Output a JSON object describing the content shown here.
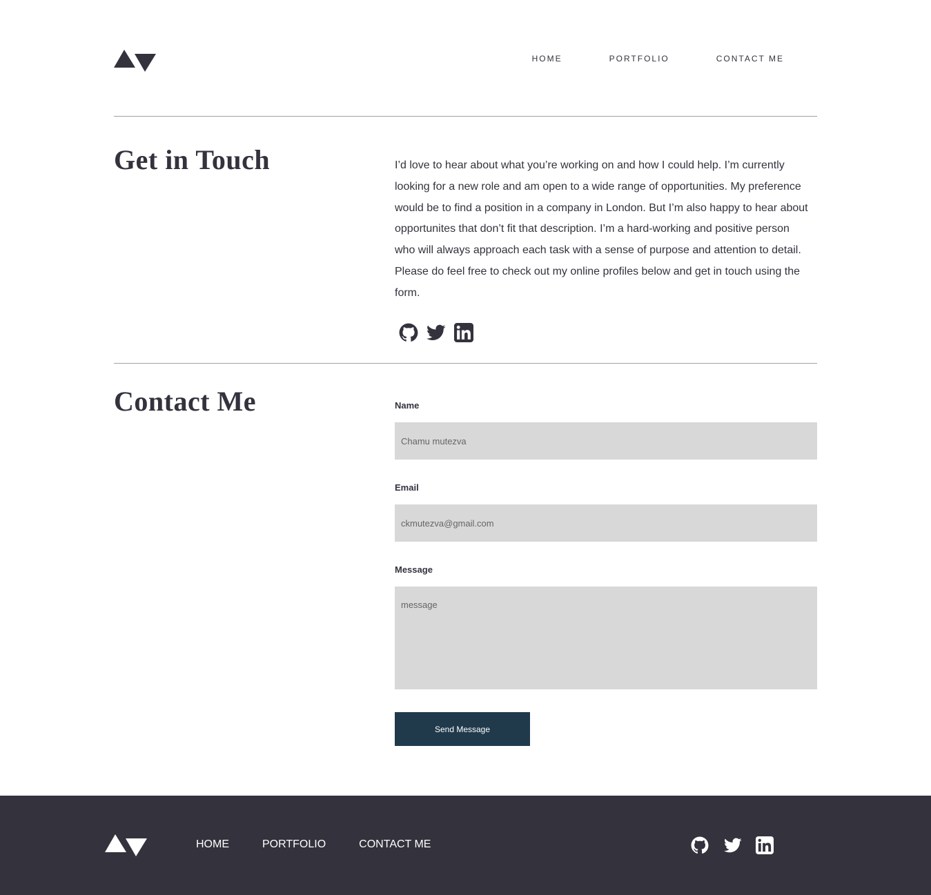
{
  "header": {
    "nav": {
      "home": "HOME",
      "portfolio": "PORTFOLIO",
      "contact": "CONTACT ME"
    }
  },
  "get_in_touch": {
    "title": "Get in Touch",
    "body": "I’d love to hear about what you’re working on and how I could help. I’m currently looking for a new role and am open to a wide range of opportunities. My preference would be to find a position in a company in London. But I’m also happy to hear about opportunites that don’t fit that description. I’m a hard-working and positive person who will always approach each task with a sense of purpose and attention to detail. Please do feel free to check out my online profiles below and get in touch using the form.",
    "social_icons": [
      "github-icon",
      "twitter-icon",
      "linkedin-icon"
    ]
  },
  "contact_form": {
    "title": "Contact Me",
    "name_label": "Name",
    "name_value": "Chamu mutezva",
    "email_label": "Email",
    "email_value": "ckmutezva@gmail.com",
    "message_label": "Message",
    "message_placeholder": "message",
    "submit_label": "Send Message"
  },
  "footer": {
    "nav": {
      "home": "HOME",
      "portfolio": "PORTFOLIO",
      "contact": "CONTACT ME"
    },
    "social_icons": [
      "github-icon",
      "twitter-icon",
      "linkedin-icon"
    ]
  },
  "colors": {
    "text_dark": "#33323d",
    "footer_bg": "#33323d",
    "button_bg": "#203a4c",
    "field_bg": "#d8d8d8"
  }
}
